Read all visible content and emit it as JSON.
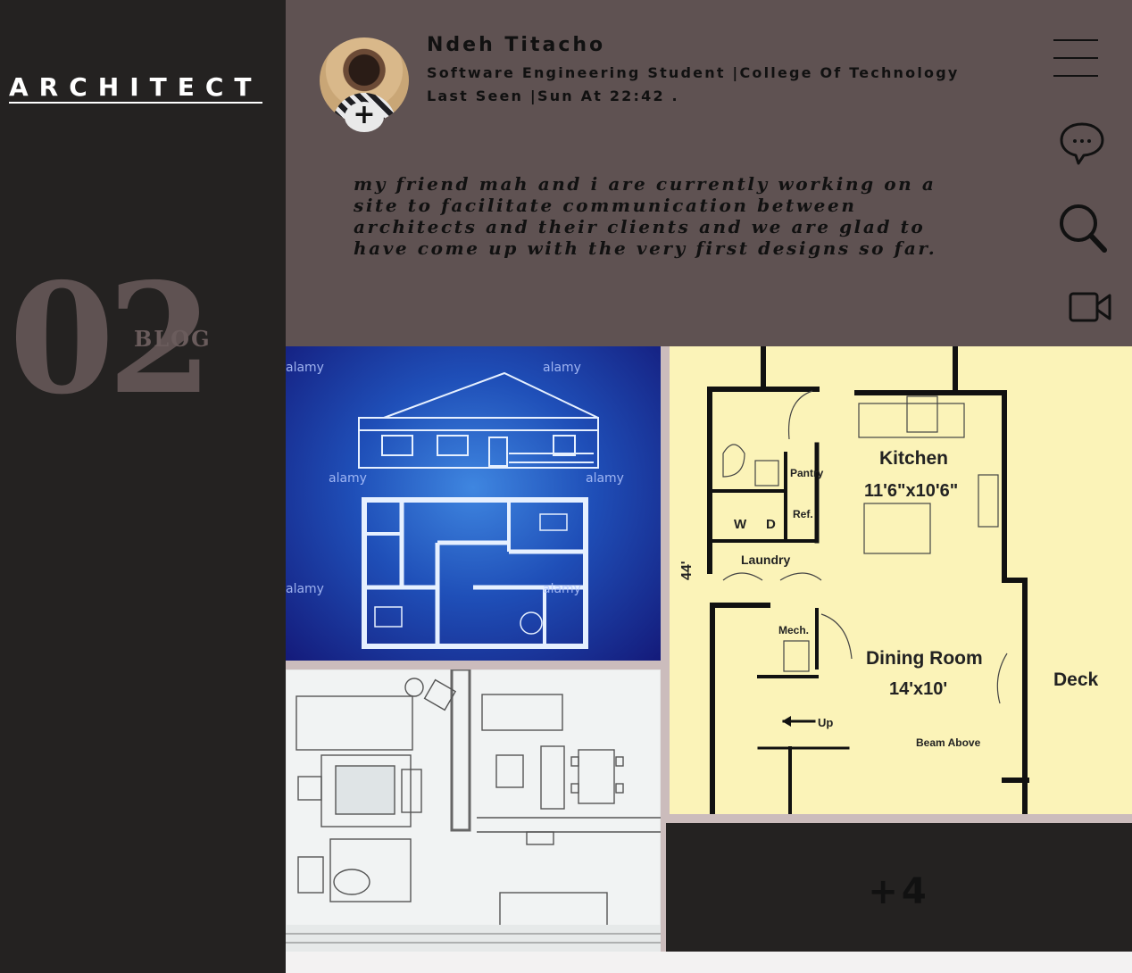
{
  "sidebar": {
    "brand": "ARCHITECT",
    "number": "02",
    "tag": "BLOG"
  },
  "profile": {
    "name": "Ndeh Titacho",
    "subtitle": "Software Engineering Student |College Of Technology",
    "last_seen": "Last Seen |Sun At 22:42 .",
    "add_symbol": "+"
  },
  "post": {
    "text": "my friend mah and i are currently working on a site to facilitate communication between architects and their clients and we are glad to have come up with the very first designs so far."
  },
  "icons": [
    "menu-icon",
    "chat-icon",
    "search-icon",
    "video-icon",
    "add-icon"
  ],
  "gallery": {
    "more_label": "+4",
    "watermark": "alamy",
    "floorplan": {
      "kitchen": "Kitchen",
      "kitchen_size": "11'6\"x10'6\"",
      "pantry": "Pantry",
      "ref": "Ref.",
      "washer": "W",
      "dryer": "D",
      "laundry": "Laundry",
      "mech": "Mech.",
      "dining": "Dining Room",
      "dining_size": "14'x10'",
      "deck": "Deck",
      "up": "Up",
      "beam": "Beam Above",
      "side_dim": "44'"
    }
  },
  "colors": {
    "sidebar_bg": "#242221",
    "header_bg": "#5f5252",
    "accent_number": "#5f5252",
    "text_dark": "#111111"
  }
}
